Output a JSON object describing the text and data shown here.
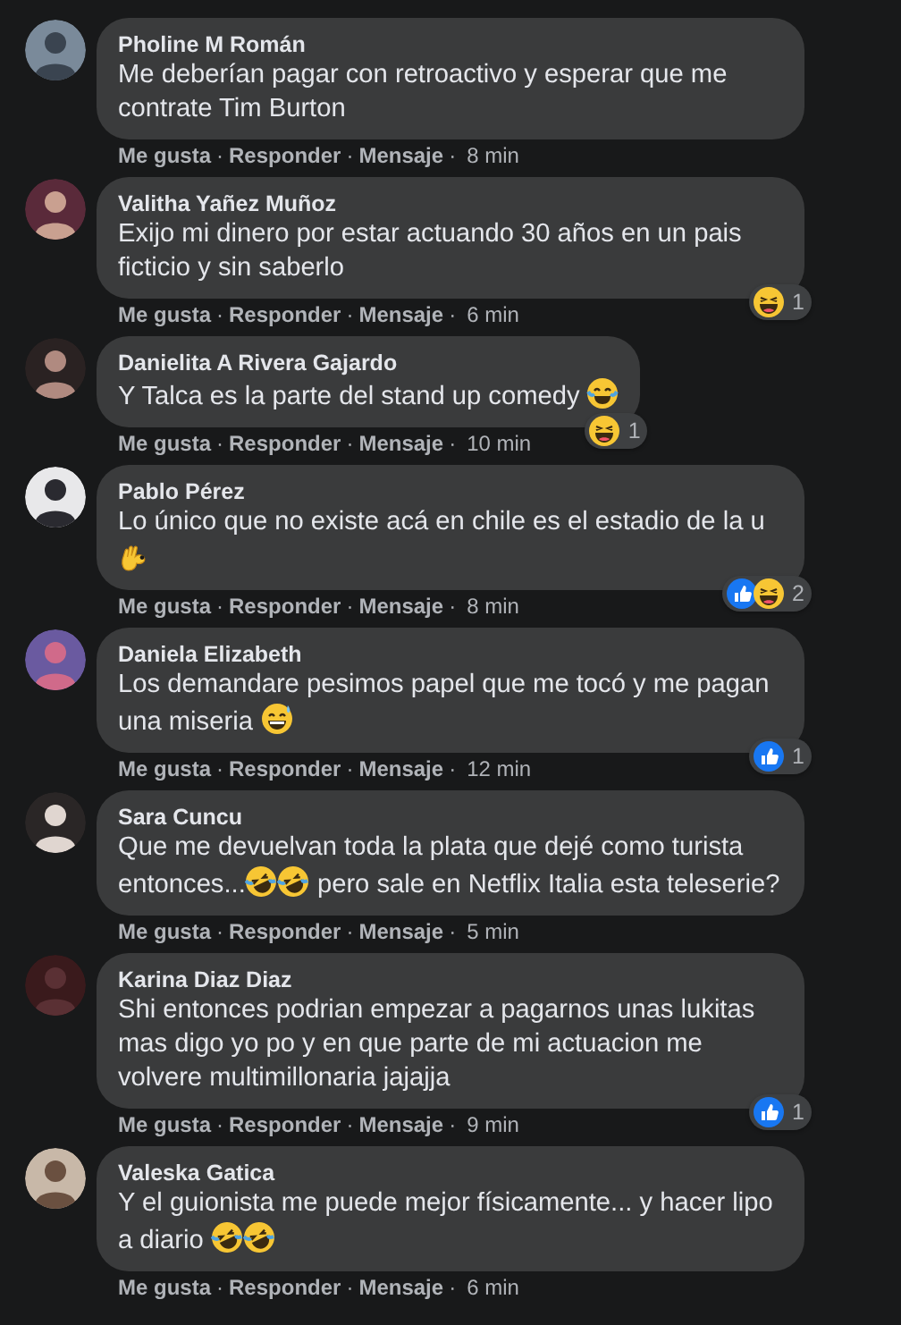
{
  "separator": "·",
  "comments": [
    {
      "author": "Pholine M Román",
      "body": [
        {
          "kind": "text",
          "text": "Me deberían pagar con retroactivo y esperar que me contrate Tim Burton"
        }
      ],
      "actions": [
        "Me gusta",
        "Responder",
        "Mensaje"
      ],
      "time": "8 min"
    },
    {
      "author": "Valitha Yañez Muñoz",
      "body": [
        {
          "kind": "text",
          "text": "Exijo mi dinero por estar actuando 30 años en un pais ficticio y sin saberlo"
        }
      ],
      "reactions": {
        "icons": [
          {
            "kind": "haha"
          }
        ],
        "count": "1"
      },
      "actions": [
        "Me gusta",
        "Responder",
        "Mensaje"
      ],
      "time": "6 min"
    },
    {
      "author": "Danielita A Rivera Gajardo",
      "body": [
        {
          "kind": "text",
          "text": "Y Talca es la parte del stand up comedy "
        },
        {
          "kind": "joy"
        }
      ],
      "reactions": {
        "icons": [
          {
            "kind": "haha"
          }
        ],
        "count": "1"
      },
      "actions": [
        "Me gusta",
        "Responder",
        "Mensaje"
      ],
      "time": "10 min"
    },
    {
      "author": "Pablo Pérez",
      "body": [
        {
          "kind": "text",
          "text": "Lo único que no existe acá en chile es el estadio de la u "
        },
        {
          "kind": "ok-hand"
        }
      ],
      "reactions": {
        "icons": [
          {
            "kind": "like"
          },
          {
            "kind": "haha"
          }
        ],
        "count": "2"
      },
      "actions": [
        "Me gusta",
        "Responder",
        "Mensaje"
      ],
      "time": "8 min"
    },
    {
      "author": "Daniela Elizabeth",
      "body": [
        {
          "kind": "text",
          "text": "Los demandare pesimos papel que me tocó y me pagan una miseria "
        },
        {
          "kind": "grin-sweat"
        }
      ],
      "reactions": {
        "icons": [
          {
            "kind": "like"
          }
        ],
        "count": "1"
      },
      "actions": [
        "Me gusta",
        "Responder",
        "Mensaje"
      ],
      "time": "12 min"
    },
    {
      "author": "Sara Cuncu",
      "body": [
        {
          "kind": "text",
          "text": "Que me devuelvan toda la plata que dejé como turista entonces..."
        },
        {
          "kind": "rofl"
        },
        {
          "kind": "rofl"
        },
        {
          "kind": "text",
          "text": " pero sale en Netflix Italia esta teleserie?"
        }
      ],
      "actions": [
        "Me gusta",
        "Responder",
        "Mensaje"
      ],
      "time": "5 min"
    },
    {
      "author": "Karina Diaz Diaz",
      "body": [
        {
          "kind": "text",
          "text": "Shi entonces podrian empezar a pagarnos unas lukitas mas digo yo po y en que parte de mi actuacion me volvere multimillonaria jajajja"
        }
      ],
      "reactions": {
        "icons": [
          {
            "kind": "like"
          }
        ],
        "count": "1"
      },
      "actions": [
        "Me gusta",
        "Responder",
        "Mensaje"
      ],
      "time": "9 min"
    },
    {
      "author": "Valeska Gatica",
      "body": [
        {
          "kind": "text",
          "text": "Y el guionista me puede mejor físicamente... y hacer lipo a diario "
        },
        {
          "kind": "rofl"
        },
        {
          "kind": "rofl"
        }
      ],
      "actions": [
        "Me gusta",
        "Responder",
        "Mensaje"
      ],
      "time": "6 min"
    }
  ]
}
